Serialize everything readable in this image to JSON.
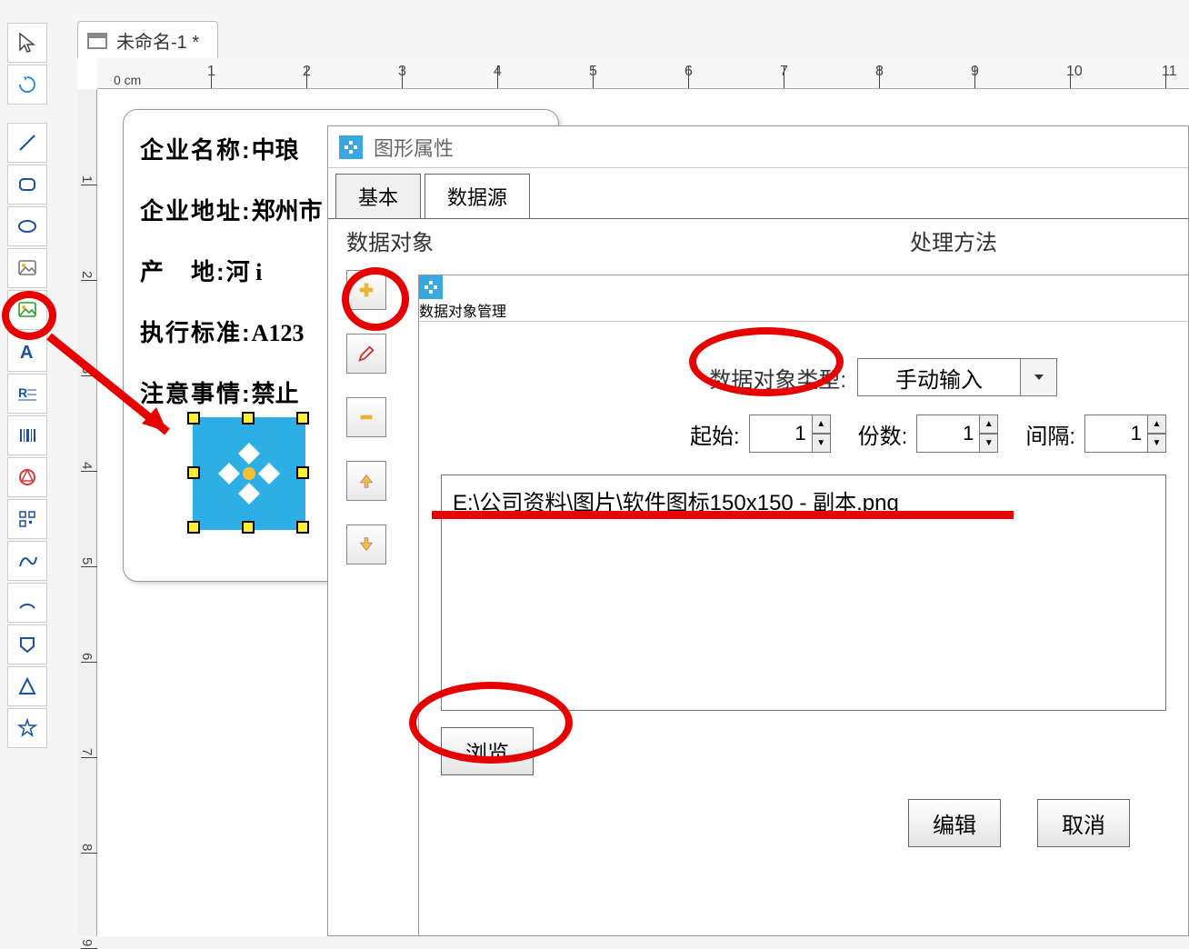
{
  "doc_tab": {
    "title": "未命名-1 *"
  },
  "ruler_unit": "0 cm",
  "page": {
    "rows": [
      {
        "label": "企业名称:",
        "value": "中琅"
      },
      {
        "label": "企业地址:",
        "value": "郑州市"
      },
      {
        "label": "产　地:",
        "value": "河 i"
      },
      {
        "label": "执行标准:",
        "value": "A123"
      },
      {
        "label": "注意事情:",
        "value": "禁止"
      }
    ]
  },
  "dlg1": {
    "title": "图形属性",
    "tabs": [
      "基本",
      "数据源"
    ],
    "section1": "数据对象",
    "section2": "处理方法"
  },
  "dlg2": {
    "title": "数据对象管理",
    "type_label": "数据对象类型:",
    "type_value": "手动输入",
    "start_label": "起始:",
    "start_value": "1",
    "count_label": "份数:",
    "count_value": "1",
    "step_label": "间隔:",
    "step_value": "1",
    "path": "E:\\公司资料\\图片\\软件图标150x150 - 副本.png",
    "browse": "浏览",
    "edit": "编辑",
    "cancel": "取消"
  }
}
